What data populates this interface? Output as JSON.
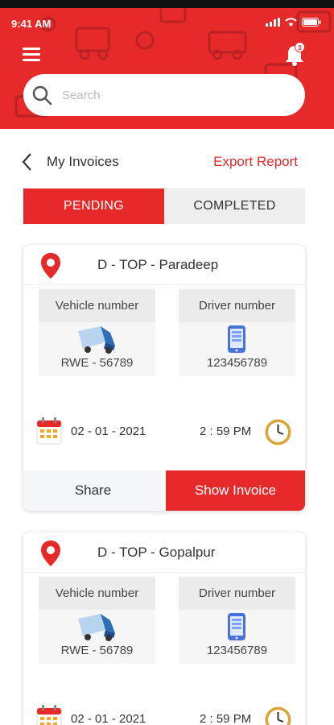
{
  "status": {
    "time": "9:41 AM"
  },
  "header": {
    "search_placeholder": "Search",
    "notification_count": "3"
  },
  "page": {
    "title": "My Invoices",
    "export_label": "Export Report"
  },
  "tabs": [
    {
      "label": "PENDING",
      "active": true
    },
    {
      "label": "COMPLETED",
      "active": false
    }
  ],
  "invoices": [
    {
      "location": "D - TOP - Paradeep",
      "vehicle_label": "Vehicle number",
      "vehicle_number": "RWE - 56789",
      "driver_label": "Driver number",
      "driver_number": "123456789",
      "date": "02 - 01 - 2021",
      "time": "2 : 59 PM",
      "share_label": "Share",
      "show_label": "Show Invoice"
    },
    {
      "location": "D - TOP - Gopalpur",
      "vehicle_label": "Vehicle number",
      "vehicle_number": "RWE - 56789",
      "driver_label": "Driver number",
      "driver_number": "123456789",
      "date": "02 - 01 - 2021",
      "time": "2 : 59 PM"
    }
  ],
  "colors": {
    "accent": "#e62a2a",
    "header_bg": "#e62a2a"
  }
}
